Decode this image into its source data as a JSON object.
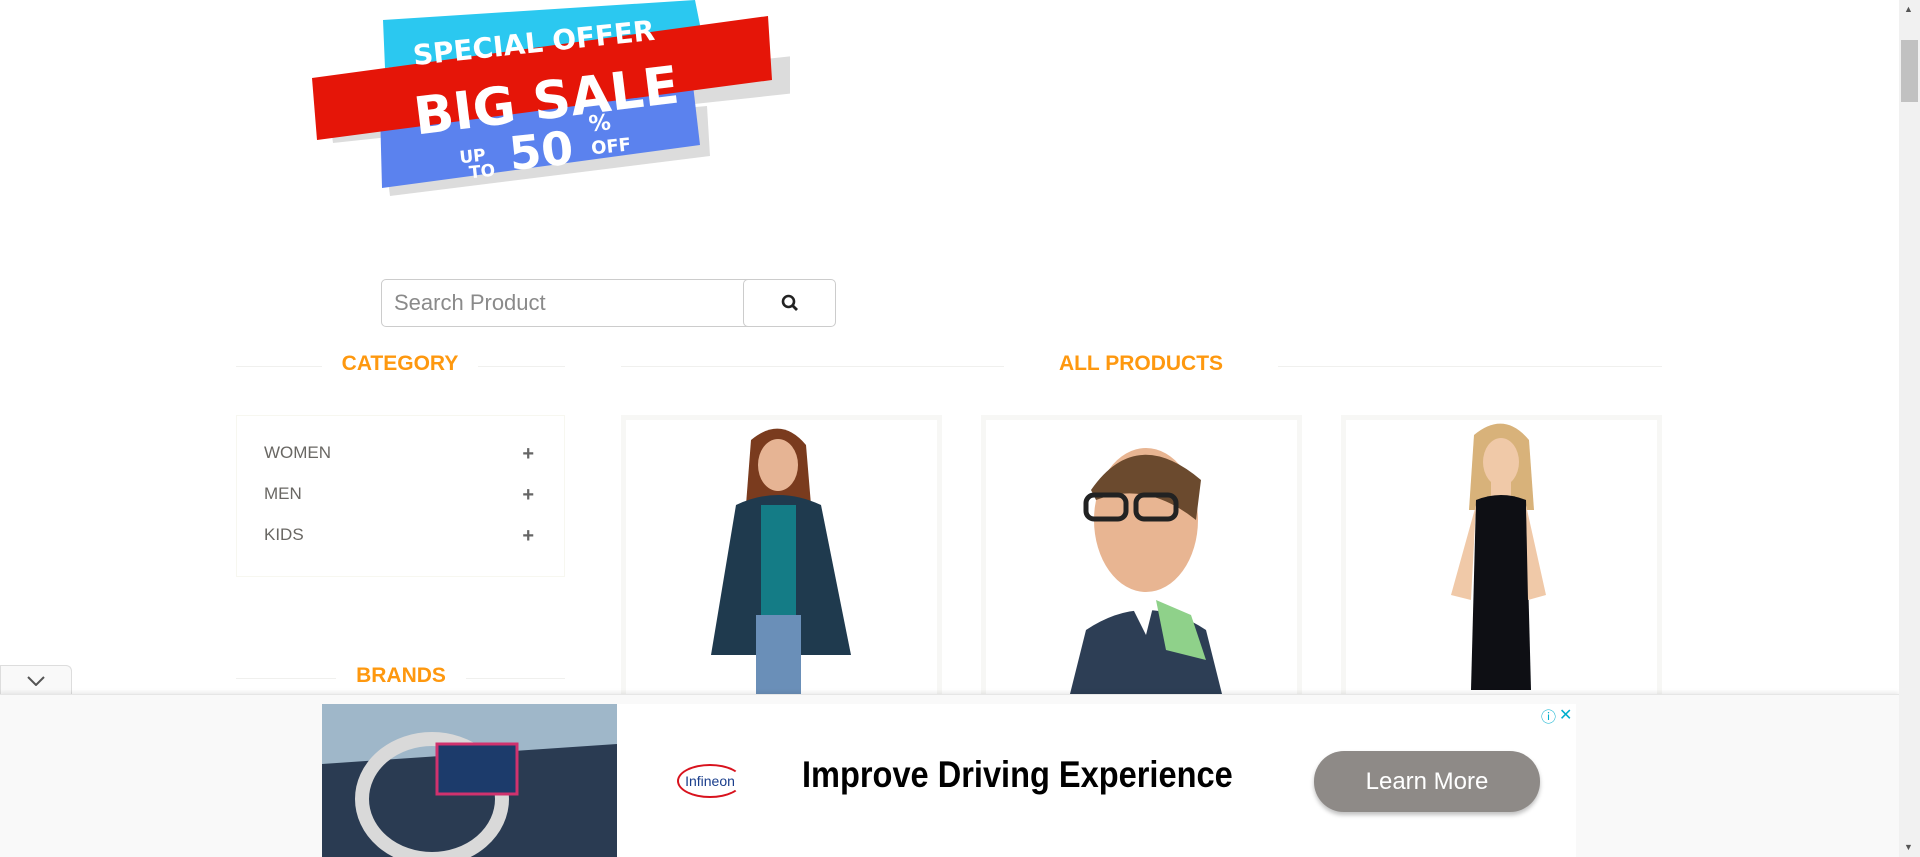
{
  "banner": {
    "line1": "SPECIAL OFFER",
    "line2": "BIG SALE",
    "up": "UP",
    "to": "TO",
    "amount": "50",
    "percent": "%",
    "off": "OFF"
  },
  "search": {
    "placeholder": "Search Product",
    "icon": "search-icon"
  },
  "category": {
    "title": "CATEGORY",
    "items": [
      {
        "label": "WOMEN",
        "icon": "+"
      },
      {
        "label": "MEN",
        "icon": "+"
      },
      {
        "label": "KIDS",
        "icon": "+"
      }
    ]
  },
  "brands": {
    "title": "BRANDS"
  },
  "products": {
    "title": "ALL PRODUCTS"
  },
  "ad": {
    "brand": "Infineon",
    "headline": "Improve Driving Experience",
    "cta": "Learn More"
  },
  "colors": {
    "accent": "#fe980f",
    "ad_button": "#8e8a87"
  }
}
